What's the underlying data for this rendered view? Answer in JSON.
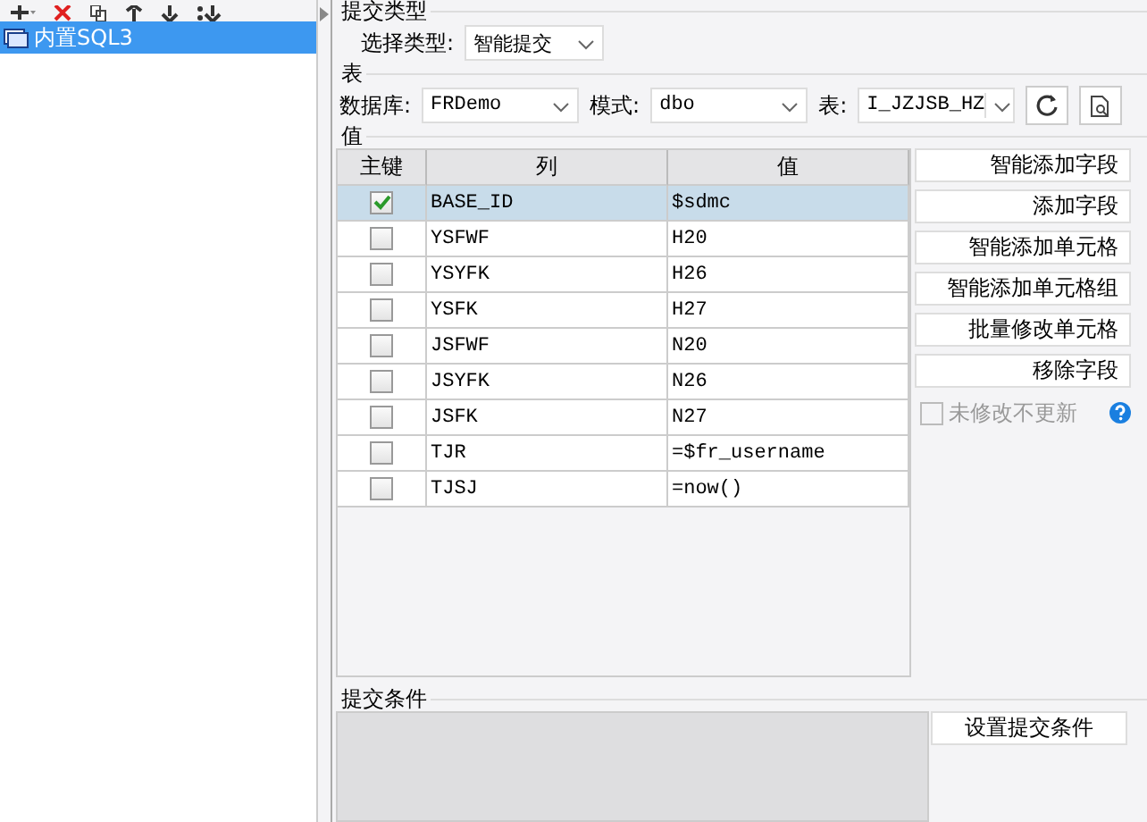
{
  "tree": {
    "items": [
      {
        "label": "内置SQL3",
        "selected": true
      }
    ]
  },
  "submit_type": {
    "legend": "提交类型",
    "label": "选择类型:",
    "value": "智能提交"
  },
  "table_section": {
    "legend": "表",
    "database_label": "数据库:",
    "database": "FRDemo",
    "schema_label": "模式:",
    "schema": "dbo",
    "table_label": "表:",
    "table": "I_JZJSB_HZ"
  },
  "values": {
    "legend": "值",
    "columns": [
      "主键",
      "列",
      "值"
    ],
    "rows": [
      {
        "key": true,
        "column": "BASE_ID",
        "value": "$sdmc",
        "selected": true
      },
      {
        "key": false,
        "column": "YSFWF",
        "value": "H20",
        "selected": false
      },
      {
        "key": false,
        "column": "YSYFK",
        "value": "H26",
        "selected": false
      },
      {
        "key": false,
        "column": "YSFK",
        "value": "H27",
        "selected": false
      },
      {
        "key": false,
        "column": "JSFWF",
        "value": "N20",
        "selected": false
      },
      {
        "key": false,
        "column": "JSYFK",
        "value": "N26",
        "selected": false
      },
      {
        "key": false,
        "column": "JSFK",
        "value": "N27",
        "selected": false
      },
      {
        "key": false,
        "column": "TJR",
        "value": "=$fr_username",
        "selected": false
      },
      {
        "key": false,
        "column": "TJSJ",
        "value": "=now()",
        "selected": false
      }
    ],
    "buttons": [
      "智能添加字段",
      "添加字段",
      "智能添加单元格",
      "智能添加单元格组",
      "批量修改单元格",
      "移除字段"
    ],
    "unchanged_checkbox": {
      "label": "未修改不更新",
      "checked": false
    }
  },
  "condition": {
    "legend": "提交条件",
    "button": "设置提交条件"
  }
}
